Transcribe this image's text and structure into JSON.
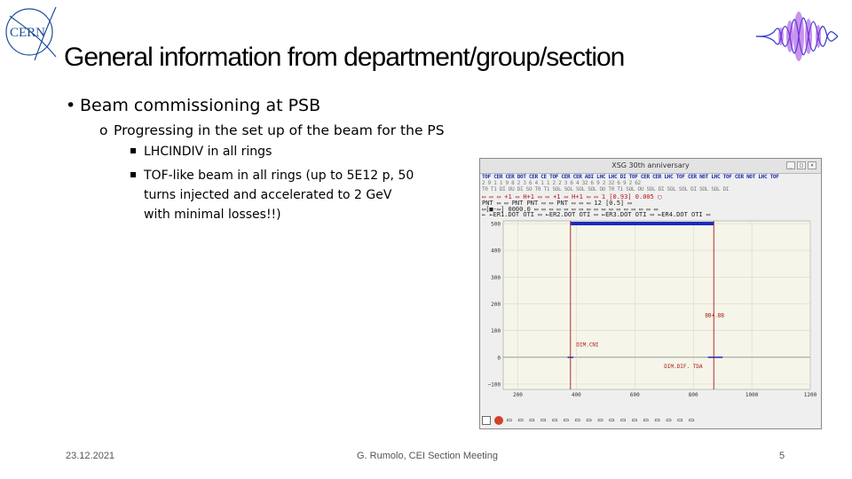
{
  "slide": {
    "title": "General information from department/group/section",
    "bullet1": "Beam commissioning at PSB",
    "bullet1_marker": "•",
    "bullet2_marker": "o",
    "bullet2": "Progressing in the set up of the beam for the PS",
    "bullet3": "LHCINDIV in all rings",
    "bullet4_line1": "TOF-like beam in all rings (up to 5E12 p, 50",
    "bullet4_line2": "turns injected and accelerated to 2 GeV",
    "bullet4_line3": "with minimal losses!!)"
  },
  "footer": {
    "date": "23.12.2021",
    "center": "G. Rumolo, CEI Section Meeting",
    "page": "5"
  },
  "logos": {
    "cern_text": "CERN"
  },
  "screenshot": {
    "window_title": "XSG 30th anniversary",
    "win_min": "_",
    "win_max": "□",
    "win_close": "×",
    "grid_row1": "TOF CER CER DOT CER CE TOF CER CER ADI LHC LHC DI TOF CER CER LHC  TOF CER NOT LHC TOF CER NOT LHC TOF",
    "grid_row2": "2   9   1   1   9   8  2   3   6   4   1   1   2  2  3  6  4   32   6  9   2  32  6  9   2  62",
    "grid_row3": "T0  T1  DI  OU  DI  SO  T0  T1 SOL SOL SOL SOL OU T0 T1 SOL  OU SOL DI  SOL SOL DI  SOL SOL DI",
    "ctrl_row1": "▭  ▭   ▭ +1 ▭ H+1 ▭   ▭ +1 ▭ H+1 ▭    ▭ 1 [0.93]   0.005 ▢",
    "ctrl_row2": "PNT  ▭ ▭  PNT  PNT  ▭ ▭   PNT  ▭   ▭  ▭ 12 [0.5]   ▭",
    "ctrl_row3": "▭[■-▭] 0000.0 ▭  ▭  ▭ ▭ ▭   ▭ ▭ ▭  ▭ ▭ ▭    ▭ ▭ ▭  ▭ ▭ ▭",
    "ctrl_row4": "←  ←ER1.DOT  OTI ▭ ←ER2.DOT  OTI ▭ ←ER3.DOT  OTI ▭ ←ER4.DOT  OTI ▭",
    "chart_data": {
      "type": "scatter",
      "y_ticks": [
        "500",
        "400",
        "300",
        "200",
        "100",
        "0",
        "−100"
      ],
      "x_ticks": [
        "200",
        "400",
        "600",
        "800",
        "1000",
        "1200"
      ],
      "xlim": [
        150,
        1200
      ],
      "ylim": [
        -120,
        510
      ],
      "series": [
        {
          "values_desc": "band",
          "x": [
            380,
            870
          ],
          "y": [
            500,
            500
          ]
        },
        {
          "values_desc": "trace",
          "x": [
            370,
            390,
            850,
            900
          ],
          "y": [
            0,
            0,
            0,
            0
          ]
        }
      ],
      "annotations": [
        {
          "text": "DIM.CNI",
          "x": 400,
          "y": 40
        },
        {
          "text": "BB+.BB",
          "x": 840,
          "y": 150
        },
        {
          "text": "DIM.DIF. TDA",
          "x": 700,
          "y": -40
        }
      ],
      "vlines": [
        380,
        870
      ],
      "colors": {
        "band": "#1a2bbd",
        "vline": "#b01818",
        "plot_bg": "#f5f5e9",
        "grid": "#d4d4c4"
      }
    },
    "bottom_bar": "▭ ▭ ▭ ▭ ▭ ▭ ▭ ▭ ▭ ▭ ▭ ▭ ▭ ▭ ▭ ▭ ▭"
  }
}
